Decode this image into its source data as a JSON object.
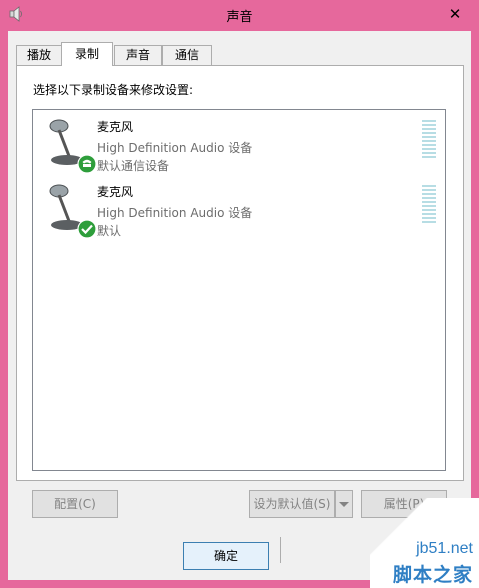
{
  "window": {
    "title": "声音",
    "close_glyph": "✕",
    "accent": "#e6689c"
  },
  "tabs": [
    {
      "label": "播放",
      "active": false
    },
    {
      "label": "录制",
      "active": true
    },
    {
      "label": "声音",
      "active": false
    },
    {
      "label": "通信",
      "active": false
    }
  ],
  "panel": {
    "prompt": "选择以下录制设备来修改设置:"
  },
  "devices": [
    {
      "name": "麦克风",
      "description": "High Definition Audio 设备",
      "status": "默认通信设备",
      "badge": "phone-icon"
    },
    {
      "name": "麦克风",
      "description": "High Definition Audio 设备",
      "status": "默认",
      "badge": "checkmark-icon"
    }
  ],
  "buttons": {
    "configure": "配置(C)",
    "set_default": "设为默认值(S)",
    "properties": "属性(P)",
    "ok": "确定"
  },
  "watermark": {
    "url": "jb51.net",
    "brand": "脚本之家"
  }
}
